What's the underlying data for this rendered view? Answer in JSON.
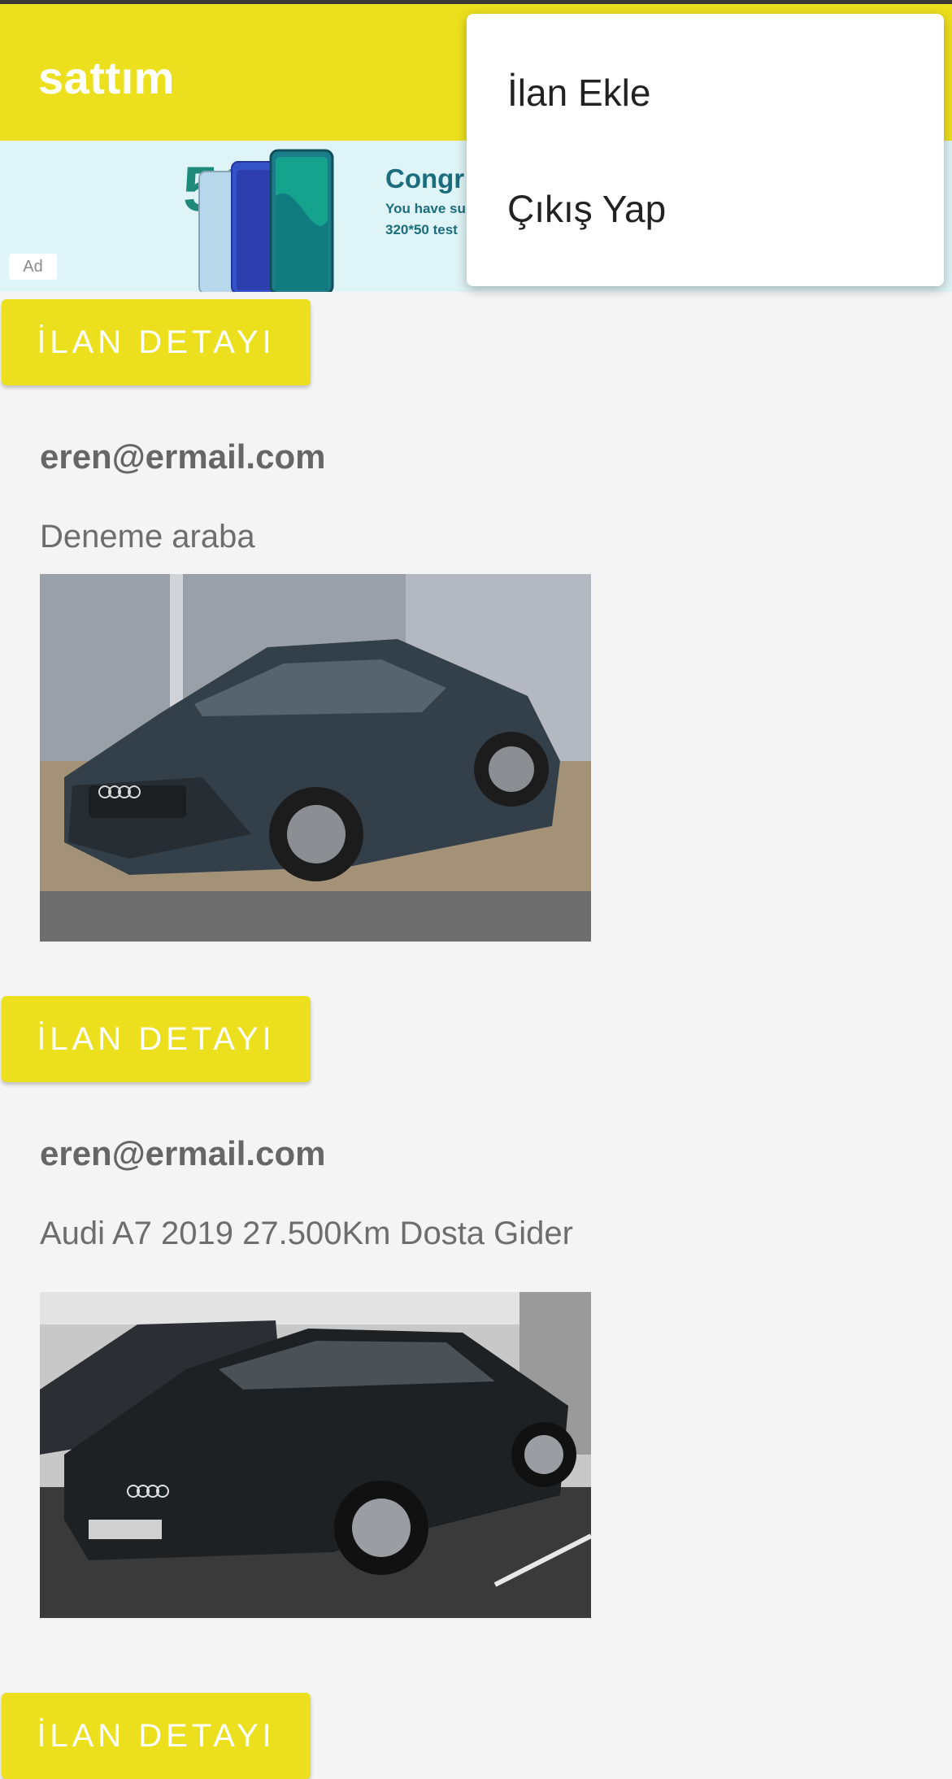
{
  "app": {
    "title": "sattım",
    "bar_color": "#ece01e"
  },
  "ad": {
    "headline": "Congr",
    "line1": "You have su",
    "line2": "320*50 test",
    "badge": "Ad",
    "logo": "5G"
  },
  "menu": {
    "items": [
      {
        "label": "İlan Ekle"
      },
      {
        "label": "Çıkış Yap"
      }
    ]
  },
  "listings": [
    {
      "button_label": "İLAN DETAYI",
      "email": "eren@ermail.com",
      "description": "Deneme araba",
      "image_icon": "car-photo"
    },
    {
      "button_label": "İLAN DETAYI",
      "email": "eren@ermail.com",
      "description": "Audi A7 2019 27.500Km Dosta Gider",
      "image_icon": "car-photo"
    },
    {
      "button_label": "İLAN DETAYI"
    }
  ]
}
